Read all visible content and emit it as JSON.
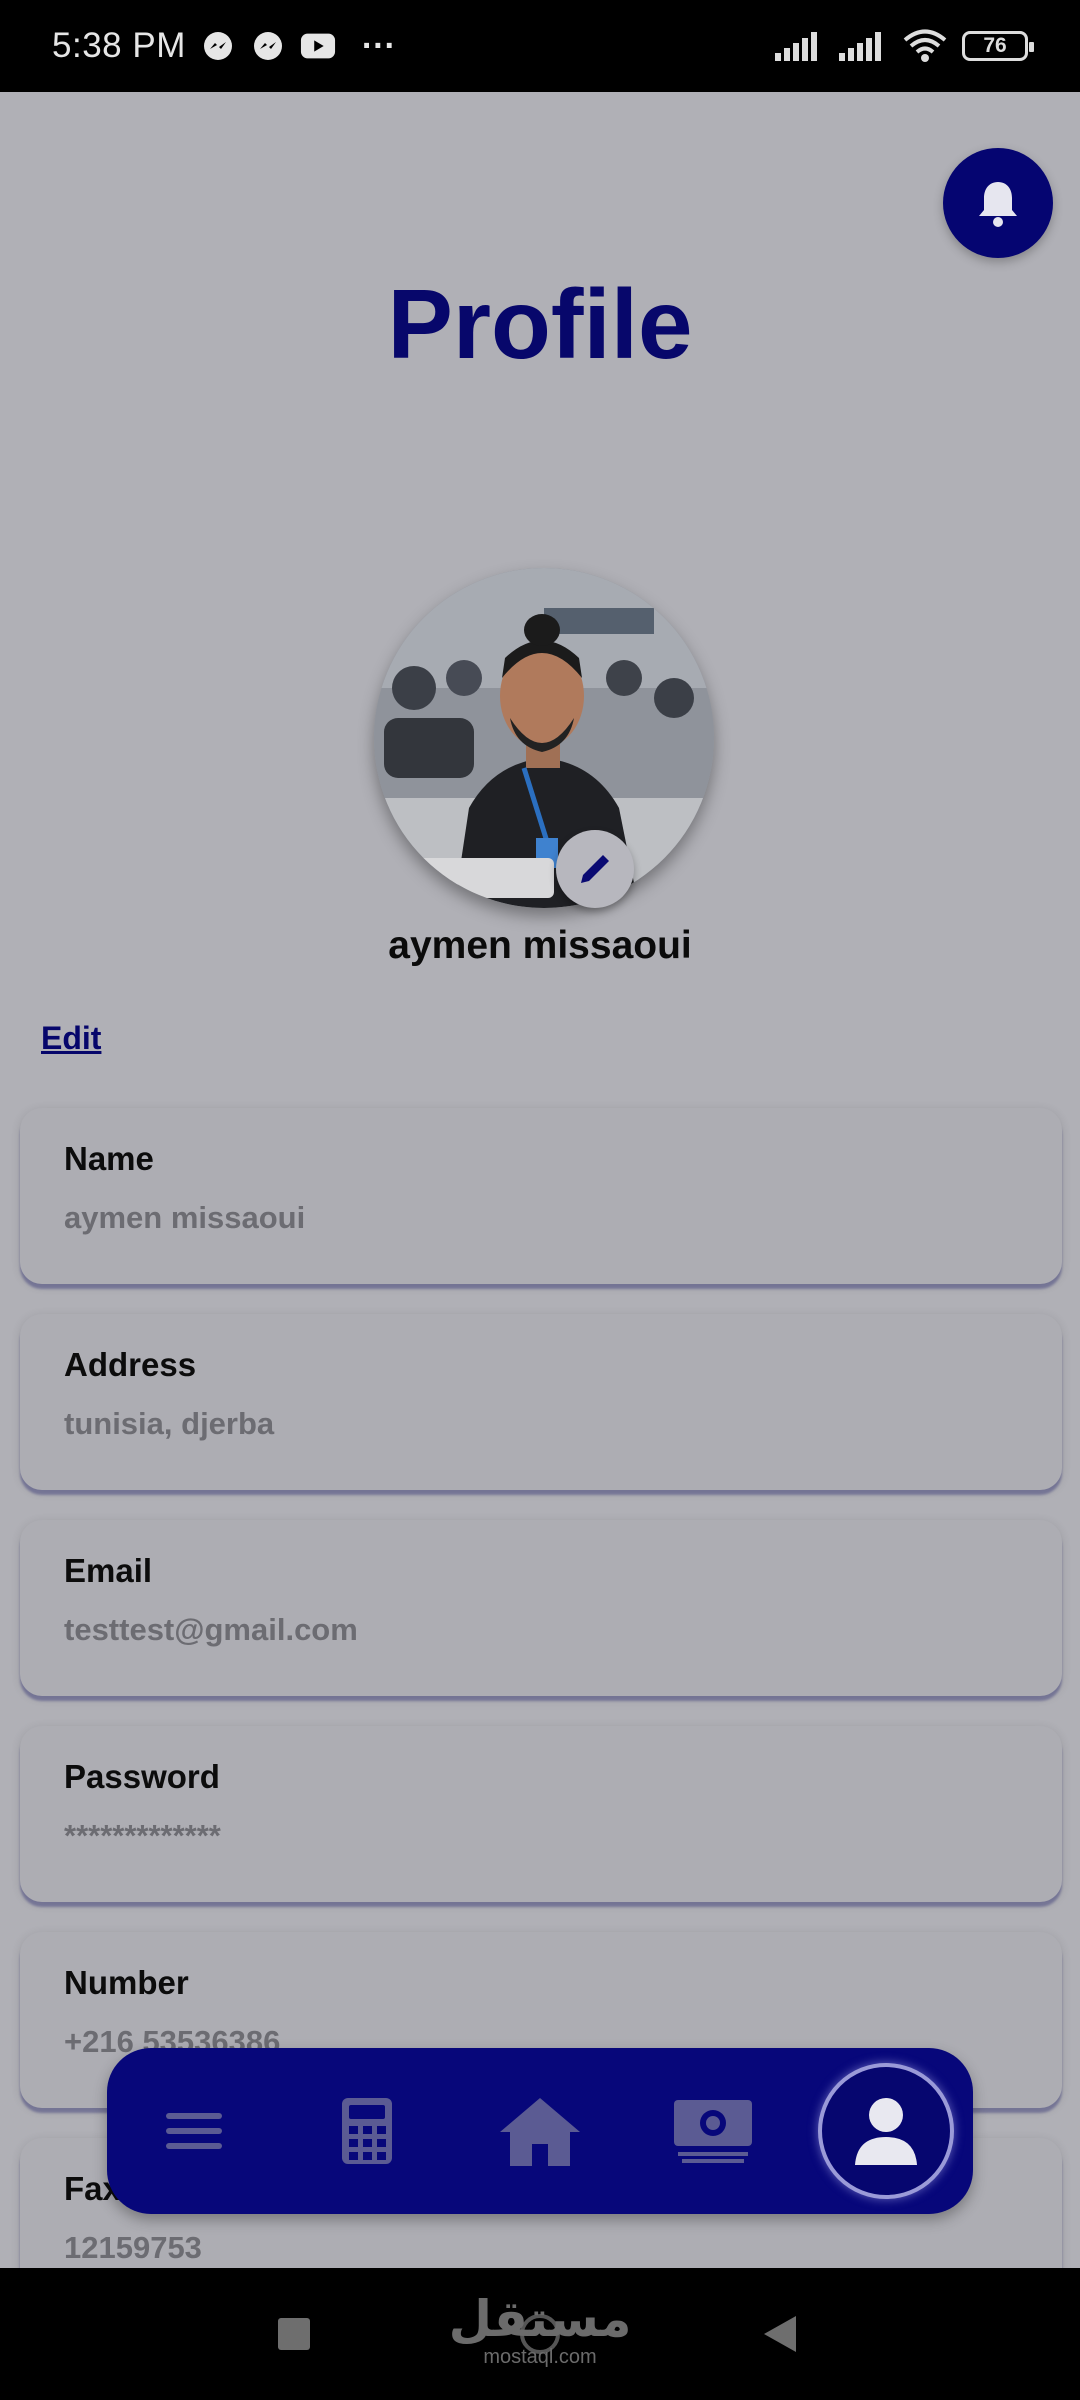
{
  "status_bar": {
    "time": "5:38 PM",
    "more_indicator": "···",
    "battery_level": "76",
    "icons": [
      "messenger-icon",
      "messenger-icon",
      "youtube-icon",
      "signal-icon",
      "signal-icon",
      "wifi-icon",
      "battery-icon"
    ]
  },
  "header": {
    "title": "Profile",
    "bell_icon": "bell-icon"
  },
  "profile": {
    "display_name": "aymen missaoui",
    "edit_label": "Edit"
  },
  "fields": [
    {
      "label": "Name",
      "value": "aymen missaoui"
    },
    {
      "label": "Address",
      "value": "tunisia, djerba"
    },
    {
      "label": "Email",
      "value": "testtest@gmail.com"
    },
    {
      "label": "Password",
      "value": "*************"
    },
    {
      "label": "Number",
      "value": "+216 53536386"
    },
    {
      "label": "Fax",
      "value": "12159753"
    }
  ],
  "bottom_nav": {
    "items": [
      "menu-icon",
      "calculator-icon",
      "home-icon",
      "money-icon",
      "user-icon"
    ],
    "active": "user-icon"
  },
  "watermark": {
    "arabic": "مستقل",
    "latin": "mostaql.com"
  },
  "colors": {
    "primary": "#07077a",
    "title": "#07076b",
    "background": "#b0b0b6"
  }
}
